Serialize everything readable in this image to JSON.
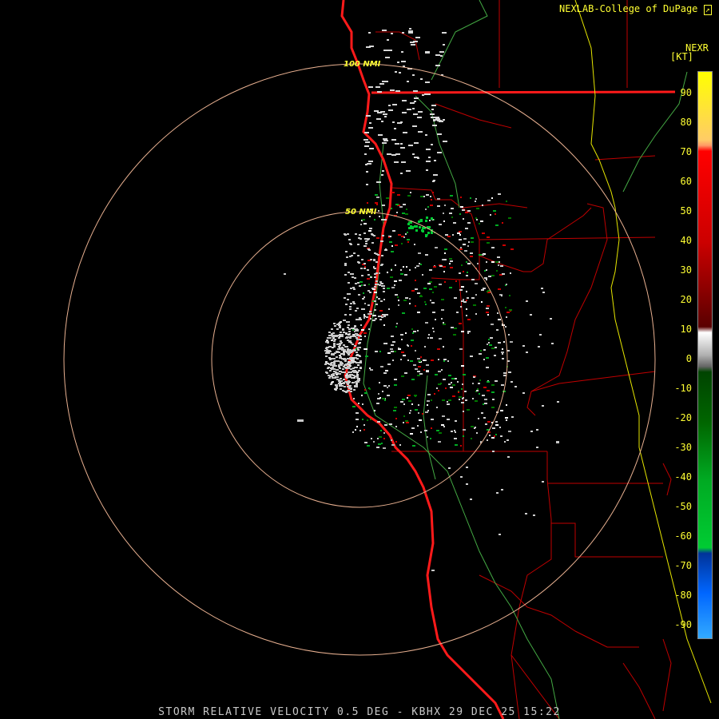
{
  "credit": {
    "text": "NEXLAB-College of DuPage",
    "icon": "logo-mark-icon"
  },
  "product_label": "NEXR",
  "unit_label": "[KT]",
  "color_scale": {
    "ticks": [
      "90",
      "80",
      "70",
      "60",
      "50",
      "40",
      "30",
      "20",
      "10",
      "0",
      "-10",
      "-20",
      "-30",
      "-40",
      "-50",
      "-60",
      "-70",
      "-80",
      "-90"
    ],
    "colors": {
      "pos_high": "#ffff00",
      "pos_mid": "#ff0000",
      "pos_low": "#5a0000",
      "zero": "#b0b0b0",
      "neg_low": "#004400",
      "neg_mid": "#00cc33",
      "neg_high": "#0066ff"
    }
  },
  "range_rings": [
    {
      "label": "50 NMI"
    },
    {
      "label": "100 NMI"
    }
  ],
  "caption": "STORM RELATIVE VELOCITY 0.5 DEG - KBHX 29 DEC 25 15:22"
}
